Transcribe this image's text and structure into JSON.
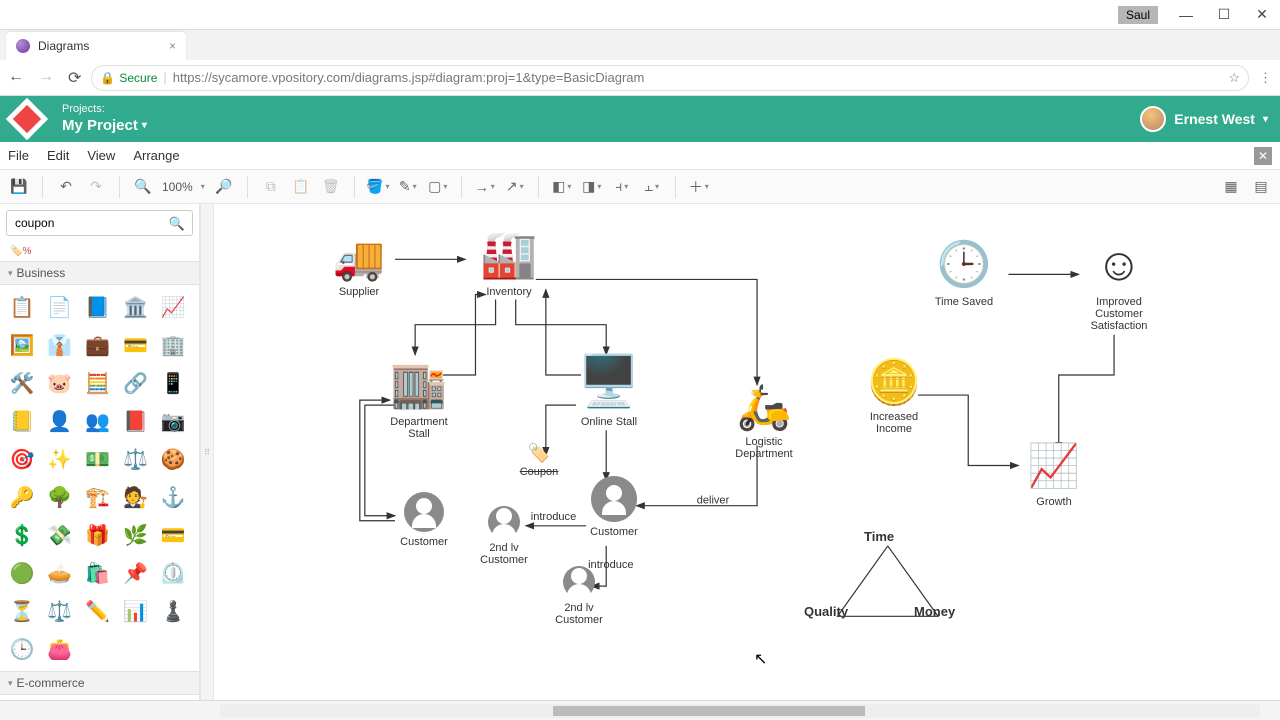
{
  "os": {
    "user_tag": "Saul"
  },
  "browser": {
    "tab_title": "Diagrams",
    "secure_label": "Secure",
    "url": "https://sycamore.vpository.com/diagrams.jsp#diagram:proj=1&type=BasicDiagram"
  },
  "header": {
    "projects_label": "Projects:",
    "project_name": "My Project",
    "user_name": "Ernest West"
  },
  "menubar": {
    "file": "File",
    "edit": "Edit",
    "view": "View",
    "arrange": "Arrange"
  },
  "toolbar": {
    "zoom": "100%"
  },
  "sidebar": {
    "search_value": "coupon",
    "categories": {
      "business": "Business",
      "ecommerce": "E-commerce"
    },
    "shapes": [
      "📋",
      "📄",
      "📘",
      "🏛️",
      "📈",
      "🖼️",
      "👔",
      "💼",
      "💳",
      "🏢",
      "🛠️",
      "🐷",
      "🧮",
      "🔗",
      "📱",
      "📒",
      "👤",
      "👥",
      "📕",
      "📷",
      "🎯",
      "✨",
      "💵",
      "⚖️",
      "🍪",
      "🔑",
      "🌳",
      "🏗️",
      "🧑‍⚖️",
      "⚓",
      "💲",
      "💸",
      "🎁",
      "🌿",
      "💳",
      "🟢",
      "🥧",
      "🛍️",
      "📌",
      "⏲️",
      "⏳",
      "⚖️",
      "✏️",
      "📊",
      "♟️",
      "🕒",
      "👛"
    ]
  },
  "diagram": {
    "nodes": {
      "supplier": "Supplier",
      "inventory": "Inventory",
      "dept_stall": "Department\nStall",
      "online_stall": "Online Stall",
      "coupon": "Coupon",
      "logistic": "Logistic\nDepartment",
      "customer1": "Customer",
      "customer2": "Customer",
      "second_lv1": "2nd lv\nCustomer",
      "second_lv2": "2nd lv\nCustomer",
      "time_saved": "Time Saved",
      "improved": "Improved\nCustomer\nSatisfaction",
      "income": "Increased\nIncome",
      "growth": "Growth"
    },
    "edges": {
      "introduce1": "introduce",
      "introduce2": "introduce",
      "deliver": "deliver"
    },
    "triangle": {
      "time": "Time",
      "quality": "Quality",
      "money": "Money"
    }
  }
}
